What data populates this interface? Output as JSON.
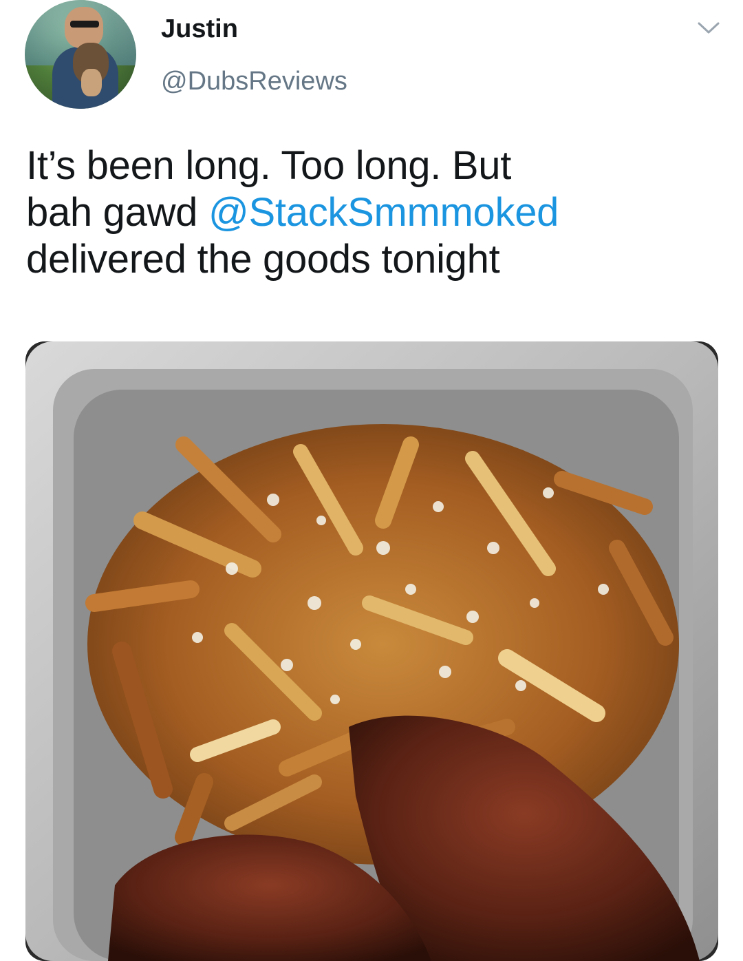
{
  "author": {
    "display_name": "Justin",
    "handle": "@DubsReviews"
  },
  "tweet": {
    "line1": "It’s been long. Too long. But",
    "line2_prefix": "bah gawd ",
    "line2_mention": "@StackSmmmoked",
    "line3": "delivered the goods tonight"
  },
  "icons": {
    "avatar": "profile-photo",
    "menu": "chevron-down-icon"
  },
  "media": {
    "description_visible": false
  },
  "colors": {
    "text": "#14171a",
    "secondary": "#657786",
    "link": "#1b95e0"
  }
}
